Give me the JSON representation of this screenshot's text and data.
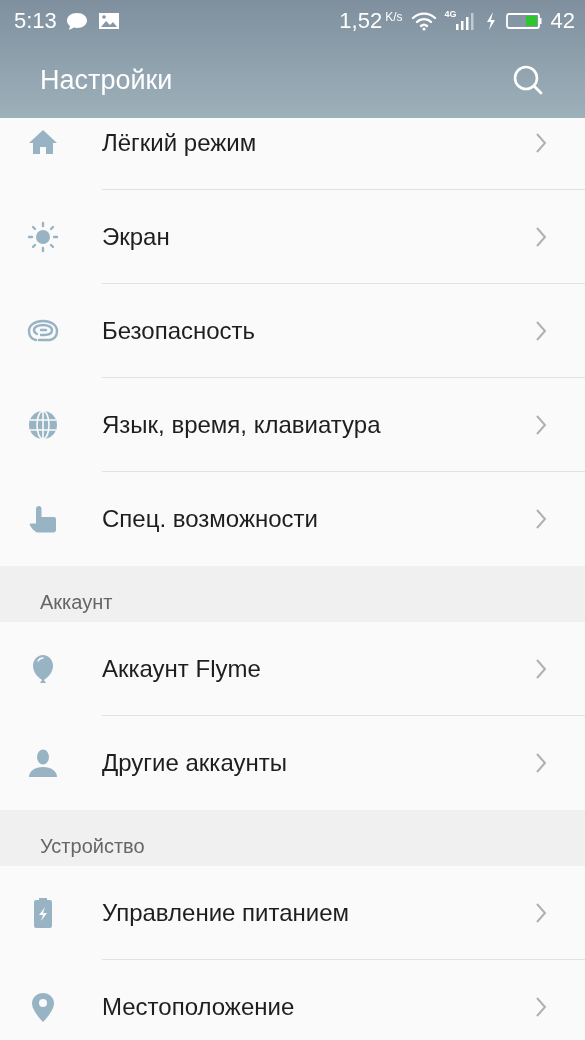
{
  "status_bar": {
    "time": "5:13",
    "speed": "1,52",
    "speed_unit": "K/s",
    "network": "4G",
    "battery": "42"
  },
  "app_bar": {
    "title": "Настройки"
  },
  "sections": [
    {
      "items": [
        {
          "label": "Лёгкий режим"
        },
        {
          "label": "Экран"
        },
        {
          "label": "Безопасность"
        },
        {
          "label": "Язык, время, клавиатура"
        },
        {
          "label": "Спец. возможности"
        }
      ]
    },
    {
      "title": "Аккаунт",
      "items": [
        {
          "label": "Аккаунт Flyme"
        },
        {
          "label": "Другие аккаунты"
        }
      ]
    },
    {
      "title": "Устройство",
      "items": [
        {
          "label": "Управление питанием"
        },
        {
          "label": "Местоположение"
        }
      ]
    }
  ]
}
